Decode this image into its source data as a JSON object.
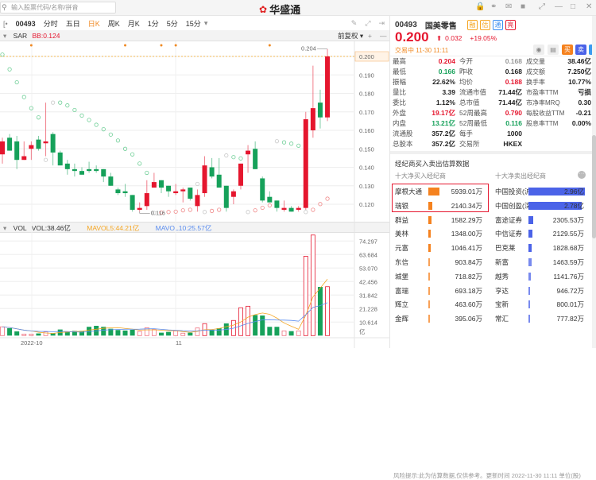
{
  "topbar": {
    "search_placeholder": "输入股票代码/名称/拼音",
    "logo": "华盛通"
  },
  "toolbar": {
    "code": "00493",
    "tabs": [
      "分时",
      "五日",
      "日K",
      "周K",
      "月K",
      "1分",
      "5分",
      "15分"
    ],
    "active": "日K"
  },
  "sar": {
    "label": "SAR",
    "bb": "BB:0.124",
    "adjust": "前复权"
  },
  "vol": {
    "label": "VOL",
    "vol": "VOL:38.46亿",
    "mavol5": "MAVOL5:44.21亿",
    "mavol10": "MAVOL10:25.57亿",
    "unit": "亿"
  },
  "price_axis": [
    "0.200",
    "0.190",
    "0.180",
    "0.170",
    "0.160",
    "0.150",
    "0.140",
    "0.130",
    "0.120"
  ],
  "vol_axis": [
    "74.297",
    "63.684",
    "53.070",
    "42.456",
    "31.842",
    "21.228",
    "10.614"
  ],
  "date_labels": [
    "2022-10",
    "11"
  ],
  "high_label": "0.204",
  "low_label": "0.116",
  "last_label": "0.200",
  "colors": {
    "up": "#e5162e",
    "down": "#16a15a",
    "mavol5": "#f5a623",
    "mavol10": "#5b8def"
  },
  "candles": [
    [
      0.147,
      0.154,
      0.156,
      0.142
    ],
    [
      0.156,
      0.149,
      0.158,
      0.149
    ],
    [
      0.154,
      0.144,
      0.157,
      0.139
    ],
    [
      0.144,
      0.146,
      0.154,
      0.144
    ],
    [
      0.15,
      0.152,
      0.154,
      0.144
    ],
    [
      0.155,
      0.15,
      0.157,
      0.149
    ],
    [
      0.153,
      0.154,
      0.175,
      0.146
    ],
    [
      0.158,
      0.148,
      0.159,
      0.141
    ],
    [
      0.148,
      0.141,
      0.149,
      0.141
    ],
    [
      0.142,
      0.139,
      0.144,
      0.136
    ],
    [
      0.139,
      0.138,
      0.142,
      0.135
    ],
    [
      0.138,
      0.136,
      0.14,
      0.136
    ],
    [
      0.139,
      0.138,
      0.143,
      0.137
    ],
    [
      0.139,
      0.138,
      0.141,
      0.137
    ],
    [
      0.139,
      0.135,
      0.139,
      0.132
    ],
    [
      0.135,
      0.13,
      0.137,
      0.13
    ],
    [
      0.128,
      0.126,
      0.129,
      0.125
    ],
    [
      0.127,
      0.126,
      0.131,
      0.124
    ],
    [
      0.125,
      0.117,
      0.125,
      0.116
    ],
    [
      0.117,
      0.118,
      0.121,
      0.116
    ],
    [
      0.119,
      0.126,
      0.133,
      0.117
    ],
    [
      0.129,
      0.132,
      0.137,
      0.129
    ],
    [
      0.133,
      0.129,
      0.133,
      0.126
    ],
    [
      0.13,
      0.127,
      0.13,
      0.124
    ],
    [
      0.126,
      0.127,
      0.131,
      0.125
    ],
    [
      0.127,
      0.128,
      0.129,
      0.121
    ],
    [
      0.129,
      0.123,
      0.129,
      0.122
    ],
    [
      0.119,
      0.125,
      0.128,
      0.116
    ],
    [
      0.126,
      0.141,
      0.146,
      0.124
    ],
    [
      0.14,
      0.135,
      0.145,
      0.134
    ],
    [
      0.136,
      0.129,
      0.145,
      0.129
    ],
    [
      0.13,
      0.118,
      0.13,
      0.116
    ],
    [
      0.124,
      0.127,
      0.128,
      0.12
    ],
    [
      0.13,
      0.142,
      0.142,
      0.128
    ],
    [
      0.147,
      0.149,
      0.152,
      0.137
    ],
    [
      0.15,
      0.139,
      0.154,
      0.139
    ],
    [
      0.134,
      0.122,
      0.135,
      0.121
    ],
    [
      0.124,
      0.121,
      0.127,
      0.121
    ],
    [
      0.122,
      0.118,
      0.122,
      0.116
    ],
    [
      0.117,
      0.118,
      0.122,
      0.116
    ],
    [
      0.118,
      0.116,
      0.119,
      0.116
    ],
    [
      0.117,
      0.118,
      0.119,
      0.116
    ],
    [
      0.118,
      0.166,
      0.17,
      0.117
    ],
    [
      0.16,
      0.172,
      0.195,
      0.156
    ],
    [
      0.175,
      0.167,
      0.182,
      0.161
    ],
    [
      0.167,
      0.2,
      0.204,
      0.165
    ]
  ],
  "sar_points": [
    [
      0.201,
      "g"
    ],
    [
      0.193,
      "g"
    ],
    [
      0.186,
      "g"
    ],
    [
      0.178,
      "g"
    ],
    [
      0.172,
      "g"
    ],
    [
      0.167,
      "g"
    ],
    [
      0.144,
      "n"
    ],
    [
      0.175,
      "n"
    ],
    [
      0.175,
      "g"
    ],
    [
      0.1735,
      "g"
    ],
    [
      0.171,
      "g"
    ],
    [
      0.168,
      "g"
    ],
    [
      0.1656,
      "g"
    ],
    [
      0.163,
      "g"
    ],
    [
      0.1606,
      "g"
    ],
    [
      0.1577,
      "g"
    ],
    [
      0.1545,
      "g"
    ],
    [
      0.15,
      "g"
    ],
    [
      0.147,
      "g"
    ],
    [
      0.142,
      "g"
    ],
    [
      0.137,
      "g"
    ],
    [
      0.1153,
      "n"
    ],
    [
      0.1155,
      "r"
    ],
    [
      0.1158,
      "r"
    ],
    [
      0.116,
      "r"
    ],
    [
      0.1167,
      "r"
    ],
    [
      0.117,
      "r"
    ],
    [
      0.131,
      "n"
    ],
    [
      0.1158,
      "n"
    ],
    [
      0.1164,
      "r"
    ],
    [
      0.117,
      "r"
    ],
    [
      0.1464,
      "n"
    ],
    [
      0.1455,
      "g"
    ],
    [
      0.1448,
      "g"
    ],
    [
      0.1158,
      "n"
    ],
    [
      0.1167,
      "r"
    ],
    [
      0.1181,
      "r"
    ],
    [
      0.1194,
      "r"
    ],
    [
      0.1541,
      "n"
    ],
    [
      0.1535,
      "g"
    ],
    [
      0.1528,
      "g"
    ],
    [
      0.1517,
      "g"
    ],
    [
      0.1158,
      "n"
    ],
    [
      0.117,
      "r"
    ],
    [
      0.1201,
      "r"
    ],
    [
      0.123,
      "r"
    ]
  ],
  "volumes": [
    6.9,
    5.8,
    3.3,
    1.2,
    1.2,
    1.7,
    2.9,
    1.7,
    4.8,
    2.9,
    3.7,
    3.7,
    6.9,
    7.7,
    6.9,
    5.4,
    4.4,
    4.0,
    4.6,
    3.3,
    6.2,
    4.8,
    2.3,
    2.9,
    3.7,
    1.9,
    2.3,
    6.0,
    9.4,
    4.4,
    5.8,
    9.6,
    11.9,
    21.9,
    23.1,
    16.2,
    15.8,
    6.9,
    6.9,
    3.7,
    3.5,
    3.7,
    62.4,
    79.1,
    38.3,
    38.46
  ],
  "event_markers": [
    4,
    17,
    22,
    24,
    37
  ],
  "stock": {
    "code": "00493",
    "name": "国美零售",
    "tags": [
      "融",
      "估",
      "通",
      "亮"
    ],
    "price": "0.200",
    "change": "0.032",
    "pct": "+19.05%",
    "status": "交易中 11-30 11:11",
    "buttons": [
      "买",
      "卖",
      "+"
    ]
  },
  "quote": [
    [
      [
        "最高",
        "0.204",
        "up"
      ],
      [
        "今开",
        "0.168",
        "gr"
      ],
      [
        "成交量",
        "38.46亿",
        ""
      ]
    ],
    [
      [
        "最低",
        "0.166",
        "dn"
      ],
      [
        "昨收",
        "0.168",
        ""
      ],
      [
        "成交额",
        "7.250亿",
        ""
      ]
    ],
    [
      [
        "振幅",
        "22.62%",
        ""
      ],
      [
        "均价",
        "0.188",
        "up"
      ],
      [
        "换手率",
        "10.77%",
        ""
      ]
    ],
    [
      [
        "量比",
        "3.39",
        ""
      ],
      [
        "流通市值",
        "71.44亿",
        ""
      ],
      [
        "市盈率TTM",
        "亏损",
        ""
      ]
    ],
    [
      [
        "委比",
        "1.12%",
        ""
      ],
      [
        "总市值",
        "71.44亿",
        ""
      ],
      [
        "市净率MRQ",
        "0.30",
        ""
      ]
    ],
    [
      [
        "外盘",
        "19.17亿",
        "up"
      ],
      [
        "52周最高",
        "0.790",
        "up"
      ],
      [
        "每股收益TTM",
        "-0.21",
        ""
      ]
    ],
    [
      [
        "内盘",
        "13.21亿",
        "dn"
      ],
      [
        "52周最低",
        "0.116",
        "dn"
      ],
      [
        "股息率TTM",
        "0.00%",
        ""
      ]
    ],
    [
      [
        "流通股",
        "357.2亿",
        ""
      ],
      [
        "每手",
        "1000",
        ""
      ],
      [
        "",
        "",
        " "
      ]
    ],
    [
      [
        "总股本",
        "357.2亿",
        ""
      ],
      [
        "交易所",
        "HKEX",
        ""
      ],
      [
        "",
        "",
        " "
      ]
    ]
  ],
  "broker": {
    "title": "经纪商买入卖出估算数据",
    "buy_title": "十大净买入经纪商",
    "sell_title": "十大净卖出经纪商",
    "more": "···",
    "buy": [
      [
        "摩根大通",
        "5939.01万",
        5939.01
      ],
      [
        "瑞银",
        "2140.34万",
        2140.34
      ],
      [
        "群益",
        "1582.29万",
        1582.29
      ],
      [
        "美林",
        "1348.00万",
        1348
      ],
      [
        "元富",
        "1046.41万",
        1046.41
      ],
      [
        "东信",
        "903.84万",
        903.84
      ],
      [
        "城堡",
        "718.82万",
        718.82
      ],
      [
        "富瑞",
        "693.18万",
        693.18
      ],
      [
        "辉立",
        "463.60万",
        463.6
      ],
      [
        "金辉",
        "395.06万",
        395.06
      ]
    ],
    "sell": [
      [
        "中国投资(沪",
        "2.96亿",
        29600
      ],
      [
        "中国创盈(深",
        "2.78亿",
        27800
      ],
      [
        "富途证券",
        "2305.53万",
        2305.53
      ],
      [
        "中信证券",
        "2129.55万",
        2129.55
      ],
      [
        "巴克莱",
        "1828.68万",
        1828.68
      ],
      [
        "新富",
        "1463.59万",
        1463.59
      ],
      [
        "越秀",
        "1141.76万",
        1141.76
      ],
      [
        "亨达",
        "946.72万",
        946.72
      ],
      [
        "宝新",
        "800.01万",
        800.01
      ],
      [
        "常汇",
        "777.82万",
        777.82
      ]
    ],
    "footer": "风险提示:此为估算数据,仅供参考。更新时间 2022-11-30 11:11 单位(股)"
  }
}
